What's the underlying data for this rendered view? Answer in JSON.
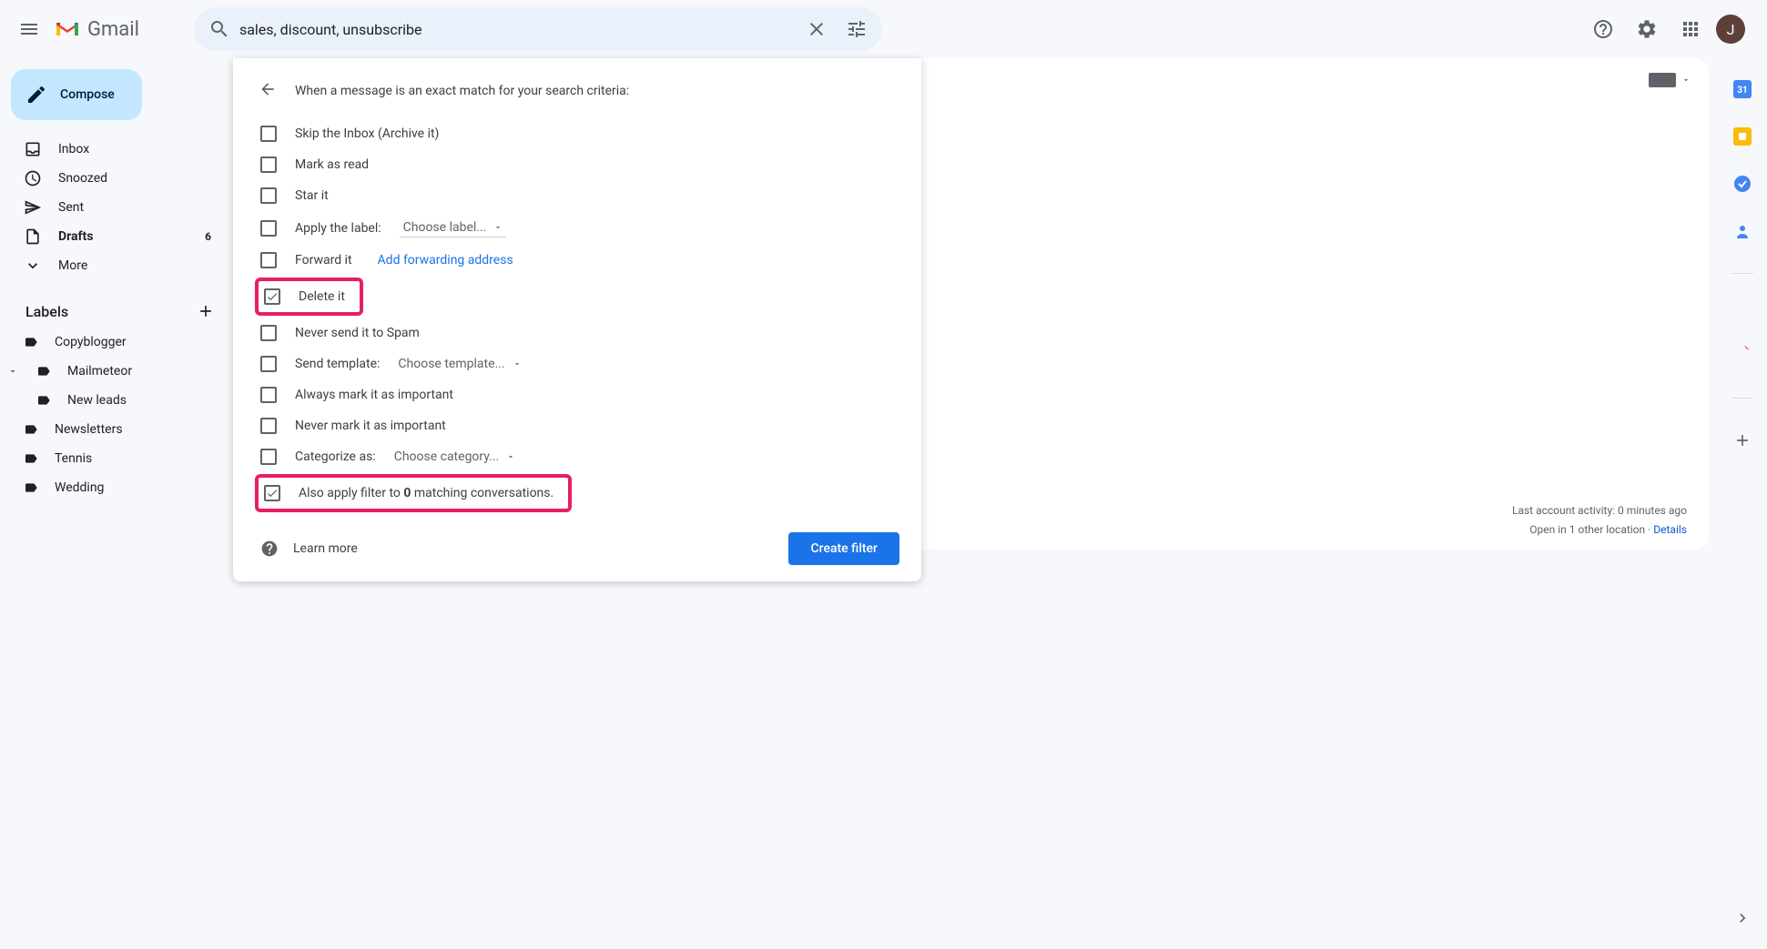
{
  "header": {
    "app_name": "Gmail",
    "search_value": "sales, discount, unsubscribe",
    "avatar_letter": "J"
  },
  "sidebar": {
    "compose_label": "Compose",
    "nav": [
      {
        "label": "Inbox"
      },
      {
        "label": "Snoozed"
      },
      {
        "label": "Sent"
      },
      {
        "label": "Drafts",
        "count": "6",
        "bold": true
      },
      {
        "label": "More"
      }
    ],
    "labels_title": "Labels",
    "labels": [
      {
        "label": "Copyblogger"
      },
      {
        "label": "Mailmeteor",
        "expandable": true
      },
      {
        "label": "New leads",
        "nested": true
      },
      {
        "label": "Newsletters"
      },
      {
        "label": "Tennis"
      },
      {
        "label": "Wedding"
      }
    ]
  },
  "filter": {
    "heading": "When a message is an exact match for your search criteria:",
    "opts": {
      "skip": "Skip the Inbox (Archive it)",
      "read": "Mark as read",
      "star": "Star it",
      "apply_label": "Apply the label:",
      "choose_label": "Choose label...",
      "forward": "Forward it",
      "add_forwarding": "Add forwarding address",
      "delete": "Delete it",
      "never_spam": "Never send it to Spam",
      "send_template": "Send template:",
      "choose_template": "Choose template...",
      "always_important": "Always mark it as important",
      "never_important": "Never mark it as important",
      "categorize": "Categorize as:",
      "choose_category": "Choose category...",
      "also_apply_pre": "Also apply filter to ",
      "also_apply_count": "0",
      "also_apply_post": " matching conversations."
    },
    "learn_more": "Learn more",
    "create_button": "Create filter"
  },
  "footer": {
    "activity": "Last account activity: 0 minutes ago",
    "open_in": "Open in 1 other location",
    "details": "Details"
  },
  "right_rail": {
    "icons": [
      "calendar",
      "keep",
      "tasks",
      "contacts"
    ]
  }
}
